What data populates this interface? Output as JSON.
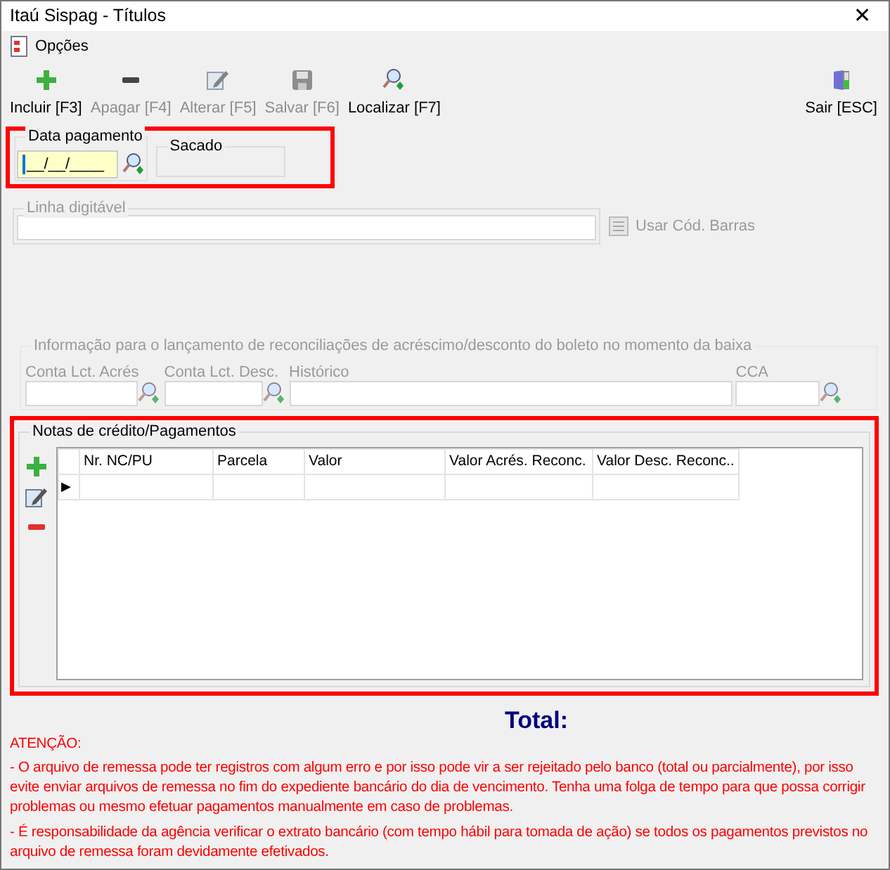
{
  "window": {
    "title": "Itaú Sispag - Títulos",
    "close": "✕"
  },
  "menu": [
    {
      "label": "Opções"
    }
  ],
  "toolbar": [
    {
      "label": "Incluir [F3]",
      "kind": "plus",
      "disabled": false
    },
    {
      "label": "Apagar [F4]",
      "kind": "minus",
      "disabled": true
    },
    {
      "label": "Alterar [F5]",
      "kind": "edit",
      "disabled": true
    },
    {
      "label": "Salvar [F6]",
      "kind": "save",
      "disabled": true
    },
    {
      "label": "Localizar [F7]",
      "kind": "find",
      "disabled": false
    },
    {
      "label": "Sair [ESC]",
      "kind": "door",
      "disabled": false
    }
  ],
  "payment": {
    "highlighted": true,
    "date_label": "Data pagamento",
    "date_value": "__/__/____",
    "payer_label": "Sacado"
  },
  "barcode_line": {
    "label": "Linha digitável",
    "checkbox_label": "Usar Cód. Barras",
    "checked": false
  },
  "reconciliation": {
    "title": "Informação para o lançamento de reconciliações de acréscimo/desconto do boleto no momento da baixa",
    "fields": [
      {
        "label": "Conta Lct. Acrés",
        "lookup": true
      },
      {
        "label": "Conta Lct. Desc.",
        "lookup": true
      },
      {
        "label": "Histórico",
        "lookup": false
      },
      {
        "label": "CCA",
        "lookup": true
      }
    ]
  },
  "credit_notes": {
    "highlighted": true,
    "title": "Notas de crédito/Pagamentos",
    "side_buttons": [
      {
        "kind": "plus"
      },
      {
        "kind": "edit"
      },
      {
        "kind": "minus"
      }
    ],
    "columns": [
      "Nr. NC/PU",
      "Parcela",
      "Valor",
      "Valor Acrés. Reconc.",
      "Valor Desc. Reconc.."
    ],
    "row_indicator": "▶"
  },
  "total_label": "Total:",
  "warning": {
    "title": "ATENÇÃO:",
    "paragraphs": [
      "- O arquivo de remessa pode ter registros com algum erro e por isso pode vir a ser rejeitado pelo banco (total ou parcialmente), por isso evite enviar arquivos de remessa no fim do expediente bancário do dia de vencimento. Tenha uma folga de tempo para que possa corrigir problemas ou mesmo efetuar pagamentos manualmente em caso de problemas.",
      "- É responsabilidade da agência verificar o extrato bancário (com tempo hábil para tomada de ação) se todos os pagamentos previstos no arquivo de remessa foram devidamente efetivados."
    ]
  }
}
